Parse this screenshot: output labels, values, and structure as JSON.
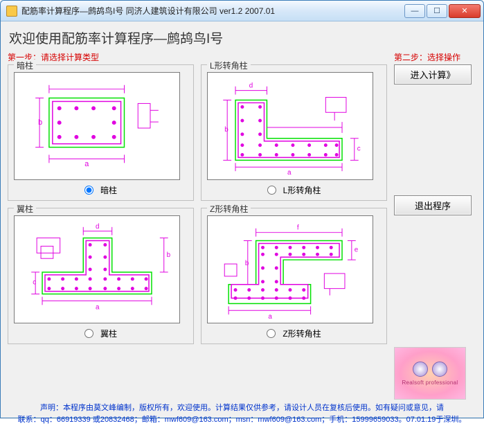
{
  "window": {
    "title": "配筋率计算程序—鹧鸪鸟I号 同济人建筑设计有限公司 ver1.2    2007.01"
  },
  "heading": "欢迎使用配筋率计算程序—鹧鸪鸟I号",
  "step1": {
    "label": "第一步：请选择计算类型",
    "options": [
      {
        "group": "暗柱",
        "radio": "暗柱",
        "checked": true
      },
      {
        "group": "L形转角柱",
        "radio": "L形转角柱",
        "checked": false
      },
      {
        "group": "翼柱",
        "radio": "翼柱",
        "checked": false
      },
      {
        "group": "Z形转角柱",
        "radio": "Z形转角柱",
        "checked": false
      }
    ]
  },
  "step2": {
    "label": "第二步：选择操作",
    "enter_btn": "进入计算》",
    "exit_btn": "退出程序"
  },
  "logo_text": "Realsoft professional",
  "footer": {
    "line1": "声明：本程序由莫文峰编制，版权所有，欢迎使用。计算结果仅供参考，请设计人员在复核后使用。如有疑问或意见，请",
    "line2": "联系：qq：66919339 或20832468；邮箱：mwf609@163.com；msn：mwf609@163.com；手机：15999659033。07.01.19于深圳。"
  }
}
